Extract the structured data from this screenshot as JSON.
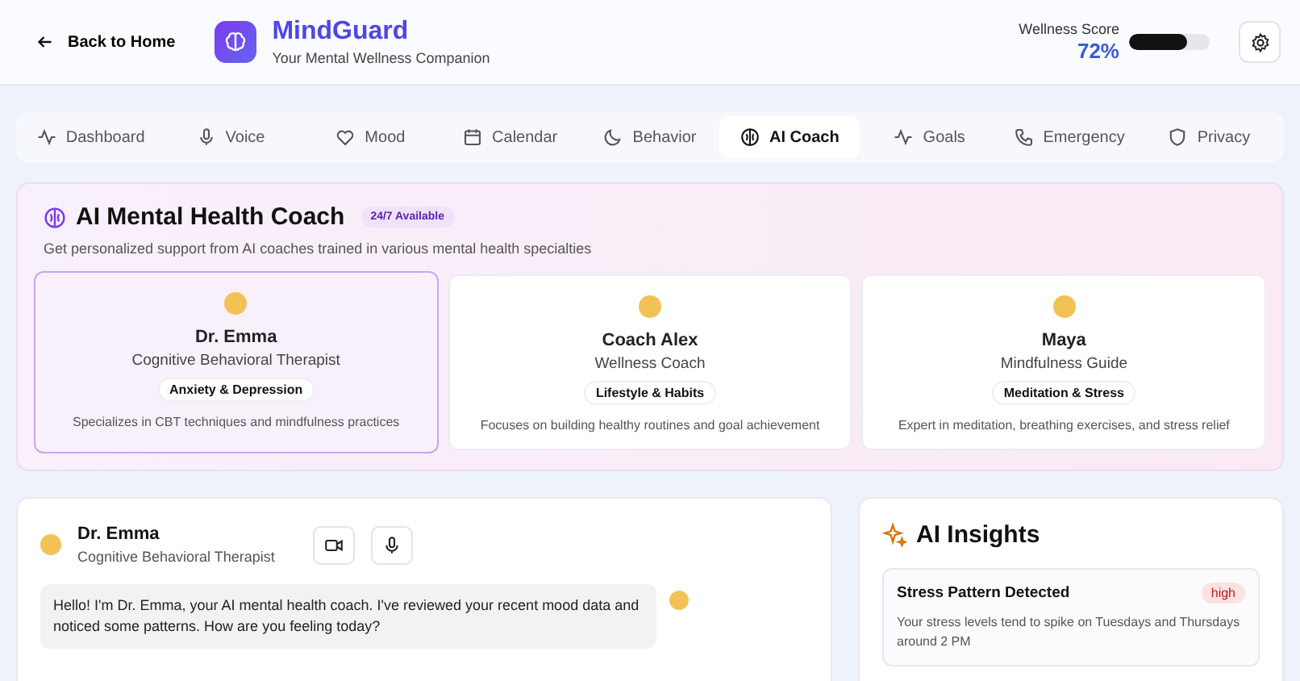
{
  "header": {
    "back": "Back to Home",
    "app_name": "MindGuard",
    "tagline": "Your Mental Wellness Companion",
    "score_label": "Wellness Score",
    "score": "72%",
    "level": 0.72
  },
  "tabs": [
    {
      "label": "Dashboard",
      "selected": false
    },
    {
      "label": "Voice",
      "selected": false
    },
    {
      "label": "Mood",
      "selected": false
    },
    {
      "label": "Calendar",
      "selected": false
    },
    {
      "label": "Behavior",
      "selected": false
    },
    {
      "label": "AI Coach",
      "selected": true
    },
    {
      "label": "Goals",
      "selected": false
    },
    {
      "label": "Emergency",
      "selected": false
    },
    {
      "label": "Privacy",
      "selected": false
    }
  ],
  "coach_panel": {
    "title": "AI Mental Health Coach",
    "badge": "24/7 Available",
    "subtitle": "Get personalized support from AI coaches trained in various mental health specialties",
    "coaches": [
      {
        "name": "Dr. Emma",
        "role": "Cognitive Behavioral Therapist",
        "tag": "Anxiety & Depression",
        "description": "Specializes in CBT techniques and mindfulness practices",
        "selected": true
      },
      {
        "name": "Coach Alex",
        "role": "Wellness Coach",
        "tag": "Lifestyle & Habits",
        "description": "Focuses on building healthy routines and goal achievement",
        "selected": false
      },
      {
        "name": "Maya",
        "role": "Mindfulness Guide",
        "tag": "Meditation & Stress",
        "description": "Expert in meditation, breathing exercises, and stress relief",
        "selected": false
      }
    ]
  },
  "chat": {
    "name": "Dr. Emma",
    "role": "Cognitive Behavioral Therapist",
    "messages": [
      "Hello! I'm Dr. Emma, your AI mental health coach. I've reviewed your recent mood data and noticed some patterns. How are you feeling today?"
    ]
  },
  "insights": {
    "title": "AI Insights",
    "items": [
      {
        "title": "Stress Pattern Detected",
        "priority": "high",
        "text": "Your stress levels tend to spike on Tuesdays and Thursdays around 2 PM"
      }
    ]
  }
}
